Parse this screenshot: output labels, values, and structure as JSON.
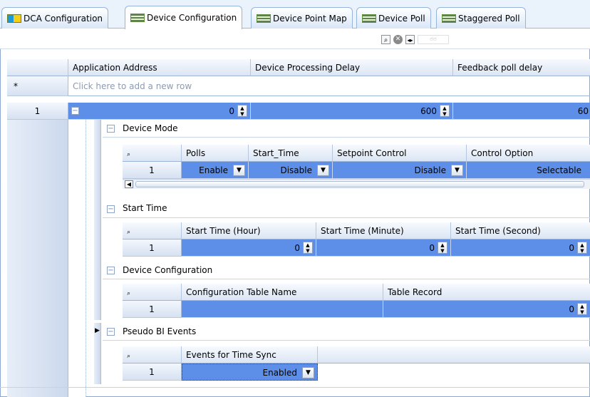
{
  "tabs": [
    {
      "label": "DCA Configuration",
      "icon": "dca-icon",
      "active": false
    },
    {
      "label": "Device Configuration",
      "icon": "grid-icon",
      "active": true
    },
    {
      "label": "Device Point Map",
      "icon": "grid-icon",
      "active": false
    },
    {
      "label": "Device Poll",
      "icon": "grid-icon",
      "active": false
    },
    {
      "label": "Staggered Poll",
      "icon": "grid-icon",
      "active": false
    }
  ],
  "findbar": {
    "search_icon": "magnifier-icon",
    "clear_icon": "clear-icon",
    "nav_icon": "left-right-arrows-icon",
    "placeholder": "ಠಠ"
  },
  "main_grid": {
    "headers": [
      "Application Address",
      "Device Processing Delay",
      "Feedback poll delay"
    ],
    "new_row_marker": "*",
    "new_row_text": "Click here to add a new row",
    "row": {
      "index": "1",
      "collapse": "−",
      "application_address": "0",
      "device_processing_delay": "600",
      "feedback_poll_delay": "60"
    }
  },
  "bands": {
    "device_mode": {
      "title": "Device Mode",
      "headers": [
        "Polls",
        "Start_Time",
        "Setpoint Control",
        "Control Option"
      ],
      "row": {
        "index": "1",
        "polls": "Enable",
        "start_time": "Disable",
        "setpoint_control": "Disable",
        "control_option": "Selectable"
      }
    },
    "start_time": {
      "title": "Start Time",
      "headers": [
        "Start Time (Hour)",
        "Start Time (Minute)",
        "Start Time (Second)"
      ],
      "row": {
        "index": "1",
        "hour": "0",
        "minute": "0",
        "second": "0"
      }
    },
    "device_configuration": {
      "title": "Device Configuration",
      "headers": [
        "Configuration Table Name",
        "Table Record"
      ],
      "row": {
        "index": "1",
        "table_name": "",
        "table_record": "0"
      }
    },
    "pseudo_bi_events": {
      "title": "Pseudo BI Events",
      "headers": [
        "Events for Time Sync"
      ],
      "row": {
        "index": "1",
        "events_for_time_sync": "Enabled"
      }
    }
  },
  "colors": {
    "selection_blue": "#5d8fe9",
    "header_bg": "#dbe5f3",
    "border": "#8ea9d0"
  }
}
